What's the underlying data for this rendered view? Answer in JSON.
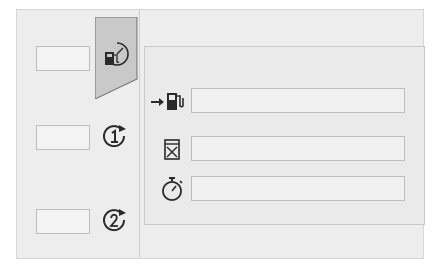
{
  "tabs": [
    {
      "id": "instant",
      "icon": "fuel-pump-gauge-icon",
      "field_value": "",
      "active": true
    },
    {
      "id": "trip1",
      "icon": "trip-1-icon",
      "field_value": "",
      "active": false
    },
    {
      "id": "trip2",
      "icon": "trip-2-icon",
      "field_value": "",
      "active": false
    }
  ],
  "info_rows": [
    {
      "icon": "fuel-range-icon",
      "value": ""
    },
    {
      "icon": "fuel-consumption-icon",
      "value": ""
    },
    {
      "icon": "stopwatch-icon",
      "value": ""
    }
  ],
  "colors": {
    "background": "#ededed",
    "active_tab": "#c9c9c9",
    "field": "#f0f0f0",
    "icon": "#2a2a2a"
  }
}
